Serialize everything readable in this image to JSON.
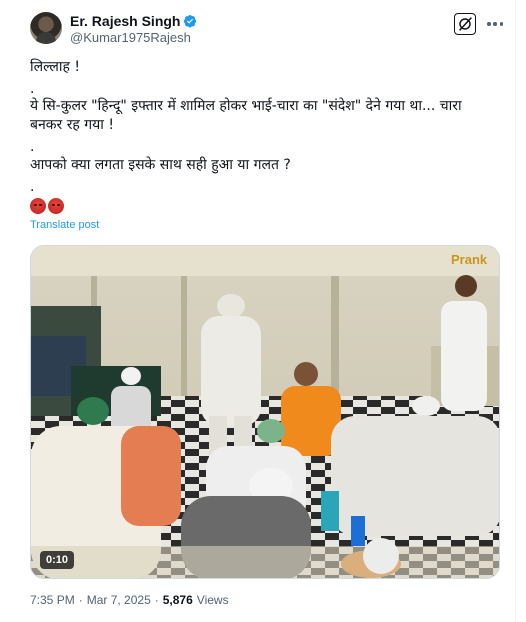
{
  "author": {
    "display_name": "Er. Rajesh Singh",
    "handle": "@Kumar1975Rajesh"
  },
  "icons": {
    "avatar": "profile-photo",
    "verified": "verified-badge-icon",
    "grok": "grok-icon",
    "more": "more-dots-icon",
    "emoji": "angry-face-emoji"
  },
  "post": {
    "line1": "लिल्लाह !",
    "dot1": ".",
    "line2a": "ये सि-कुलर \"हिन्दू\" इफ्तार में शामिल होकर भाई-चारा का \"संदेश\" देने गया था... चारा",
    "line2b": "बनकर रह गया !",
    "dot2": ".",
    "line3": "आपको क्या लगता इसके साथ सही हुआ या गलत ?",
    "dot3": ".",
    "translate_label": "Translate post"
  },
  "video": {
    "duration": "0:10",
    "watermark": "Prank"
  },
  "meta": {
    "time": "7:35 PM",
    "dot": "·",
    "date": "Mar 7, 2025",
    "views_count": "5,876",
    "views_label": "Views"
  },
  "colors": {
    "link": "#1d9bf0",
    "secondary_text": "#536471",
    "primary_text": "#0f1419",
    "verified": "#1d9bf0"
  }
}
